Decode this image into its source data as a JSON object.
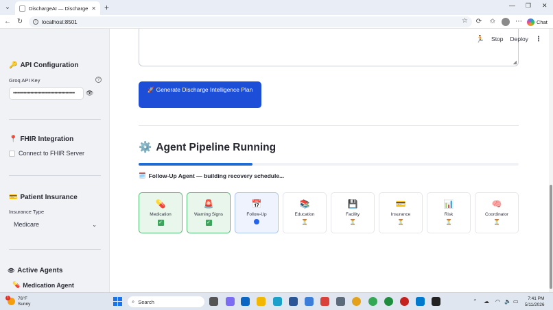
{
  "browser": {
    "tab_title": "DischargeAI — Discharge Planning",
    "url": "localhost:8501",
    "chat_label": "Chat"
  },
  "sidebar": {
    "api": {
      "heading": "API Configuration",
      "icon": "key-icon",
      "key_label": "Groq API Key",
      "key_value": "••••••••••••••••••••••••••••••••••••••••••••••"
    },
    "fhir": {
      "heading": "FHIR Integration",
      "icon": "pin-icon",
      "checkbox_label": "Connect to FHIR Server"
    },
    "insurance": {
      "heading": "Patient Insurance",
      "icon": "credit-card-icon",
      "type_label": "Insurance Type",
      "selected": "Medicare"
    },
    "agents": {
      "heading": "Active Agents",
      "icon": "eye-icon",
      "first_agent": "Medication Agent"
    }
  },
  "header": {
    "stop_label": "Stop",
    "deploy_label": "Deploy"
  },
  "main": {
    "generate_button": "Generate Discharge Intelligence Plan",
    "pipeline_heading": "Agent Pipeline Running",
    "progress": 0.3,
    "status_text": "Follow-Up Agent — building recovery schedule...",
    "agents": [
      {
        "name": "Medication",
        "icon": "pill-icon",
        "glyph": "💊",
        "state": "done"
      },
      {
        "name": "Warning Signs",
        "icon": "siren-icon",
        "glyph": "🚨",
        "state": "done"
      },
      {
        "name": "Follow-Up",
        "icon": "calendar-icon",
        "glyph": "📅",
        "state": "active"
      },
      {
        "name": "Education",
        "icon": "books-icon",
        "glyph": "📚",
        "state": "pending"
      },
      {
        "name": "Facility",
        "icon": "floppy-icon",
        "glyph": "💾",
        "state": "pending"
      },
      {
        "name": "Insurance",
        "icon": "credit-card-icon",
        "glyph": "💳",
        "state": "pending"
      },
      {
        "name": "Risk",
        "icon": "bar-chart-icon",
        "glyph": "📊",
        "state": "pending"
      },
      {
        "name": "Coordinator",
        "icon": "brain-icon",
        "glyph": "🧠",
        "state": "pending"
      }
    ]
  },
  "taskbar": {
    "temperature": "76°F",
    "weather": "Sunny",
    "weather_badge": "1",
    "search_placeholder": "Search",
    "time": "7:41 PM",
    "date": "5/11/2026"
  },
  "colors": {
    "accent": "#1d4ed8",
    "done_green": "#3ca55c",
    "sidebar_bg": "#f0f2f6"
  }
}
